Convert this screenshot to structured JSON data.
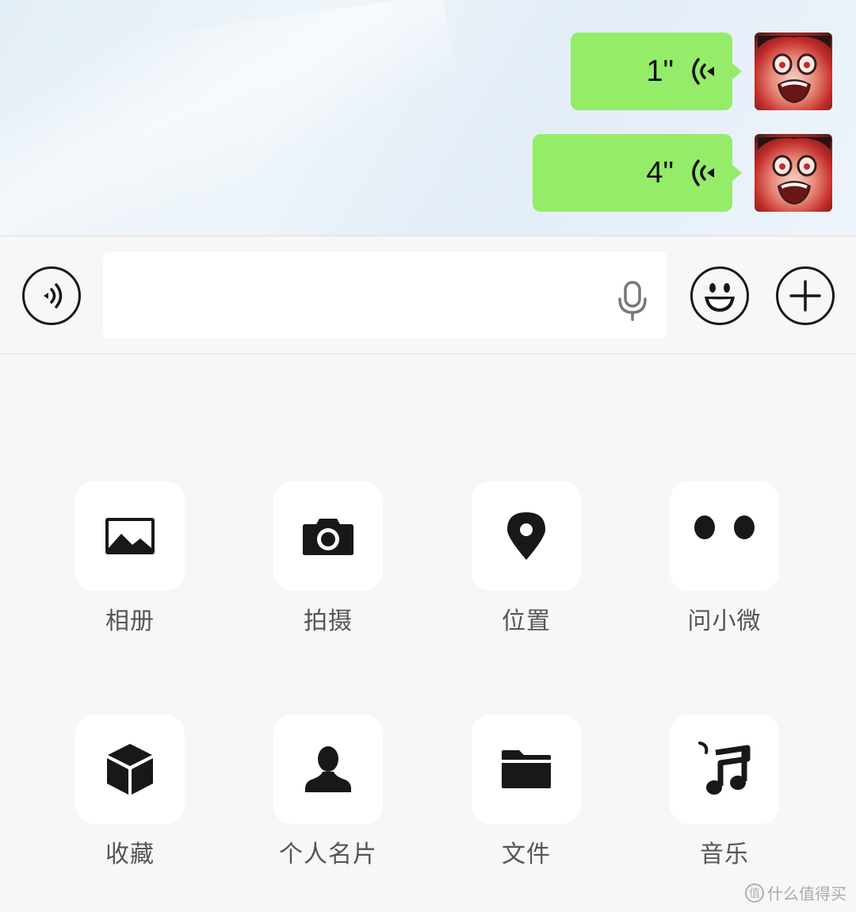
{
  "chat": {
    "messages": [
      {
        "type": "voice",
        "duration": "1\"",
        "sender": "self"
      },
      {
        "type": "voice",
        "duration": "4\"",
        "sender": "self"
      }
    ],
    "bubble_color": "#95ec69"
  },
  "input_bar": {
    "text_value": "",
    "left_icon": "voice-mode-icon",
    "right_icons": [
      "emoji-icon",
      "plus-icon"
    ],
    "inner_icon": "microphone-icon"
  },
  "panel": {
    "items": [
      {
        "label": "相册",
        "icon": "album-icon"
      },
      {
        "label": "拍摄",
        "icon": "camera-icon"
      },
      {
        "label": "位置",
        "icon": "location-icon"
      },
      {
        "label": "问小微",
        "icon": "xiaowei-icon"
      },
      {
        "label": "收藏",
        "icon": "favorites-icon"
      },
      {
        "label": "个人名片",
        "icon": "contact-card-icon"
      },
      {
        "label": "文件",
        "icon": "file-icon"
      },
      {
        "label": "音乐",
        "icon": "music-icon"
      }
    ]
  },
  "watermark": {
    "text": "什么值得买",
    "logo_char": "值"
  }
}
